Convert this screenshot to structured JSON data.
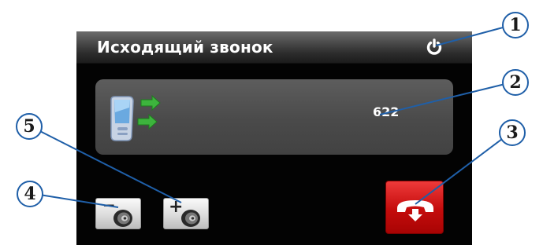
{
  "header": {
    "title": "Исходящий звонок",
    "power_icon": "power-icon"
  },
  "call": {
    "number": "622",
    "icon": "phone-call-icon"
  },
  "controls": {
    "volume_down": {
      "sign": "−",
      "icon": "speaker-icon"
    },
    "volume_up": {
      "sign": "+",
      "icon": "speaker-icon"
    },
    "hangup": {
      "icon": "hang-up-icon"
    }
  },
  "callouts": [
    "1",
    "2",
    "3",
    "4",
    "5"
  ],
  "colors": {
    "screen": "#030303",
    "panel": "#4f4f4f",
    "hangup": "#c40c0c",
    "callout_border": "#1f5fa8",
    "arrow_green": "#3db43d"
  }
}
